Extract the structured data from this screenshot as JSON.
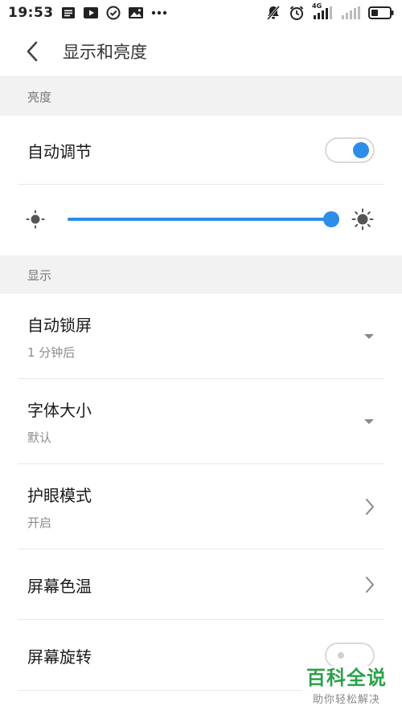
{
  "status_bar": {
    "time": "19:53",
    "network_label": "4G"
  },
  "header": {
    "title": "显示和亮度"
  },
  "brightness": {
    "section_label": "亮度",
    "auto_label": "自动调节",
    "auto_enabled": true,
    "level": 1.0
  },
  "display": {
    "section_label": "显示",
    "items": [
      {
        "title": "自动锁屏",
        "subtitle": "1 分钟后"
      },
      {
        "title": "字体大小",
        "subtitle": "默认"
      },
      {
        "title": "护眼模式",
        "subtitle": "开启"
      },
      {
        "title": "屏幕色温"
      },
      {
        "title": "屏幕旋转",
        "enabled": false
      }
    ]
  },
  "watermark": {
    "main": "百科全说",
    "sub": "助你轻松解决"
  },
  "colors": {
    "accent": "#2d8de8",
    "section_bg": "#f2f2f2"
  }
}
